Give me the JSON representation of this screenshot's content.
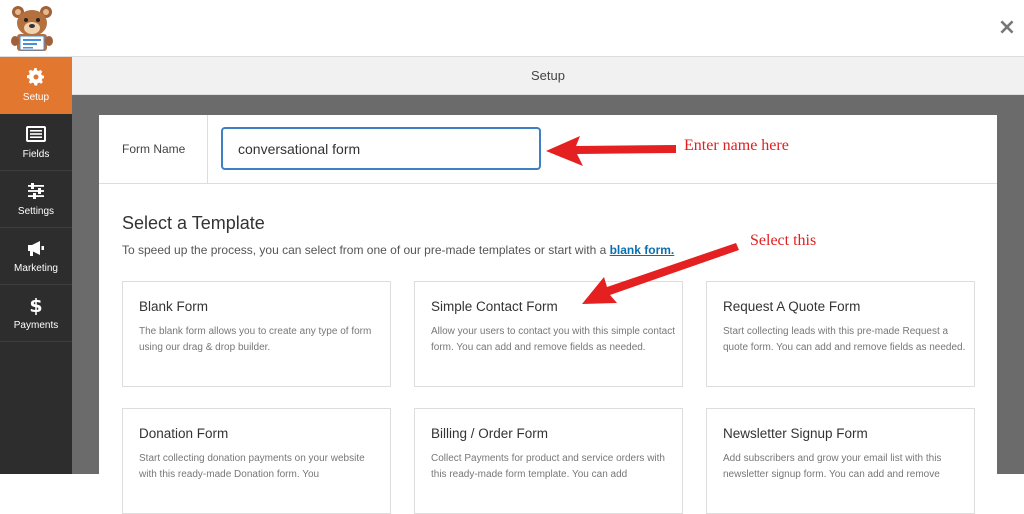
{
  "header": {
    "close_label": "×"
  },
  "sidebar": {
    "items": [
      {
        "label": "Setup",
        "icon": "gear-icon",
        "active": true
      },
      {
        "label": "Fields",
        "icon": "list-icon",
        "active": false
      },
      {
        "label": "Settings",
        "icon": "sliders-icon",
        "active": false
      },
      {
        "label": "Marketing",
        "icon": "megaphone-icon",
        "active": false
      },
      {
        "label": "Payments",
        "icon": "dollar-icon",
        "active": false
      }
    ]
  },
  "setup_bar": {
    "title": "Setup"
  },
  "form_name": {
    "label": "Form Name",
    "value": "conversational form"
  },
  "templates": {
    "title": "Select a Template",
    "description": "To speed up the process, you can select from one of our pre-made templates or start with a ",
    "blank_link": "blank form.",
    "cards": [
      {
        "title": "Blank Form",
        "desc": "The blank form allows you to create any type of form using our drag & drop builder."
      },
      {
        "title": "Simple Contact Form",
        "desc": "Allow your users to contact you with this simple contact form. You can add and remove fields as needed."
      },
      {
        "title": "Request A Quote Form",
        "desc": "Start collecting leads with this pre-made Request a quote form. You can add and remove fields as needed."
      },
      {
        "title": "Donation Form",
        "desc": "Start collecting donation payments on your website with this ready-made Donation form. You"
      },
      {
        "title": "Billing / Order Form",
        "desc": "Collect Payments for product and service orders with this ready-made form template. You can add"
      },
      {
        "title": "Newsletter Signup Form",
        "desc": "Add subscribers and grow your email list with this newsletter signup form. You can add and remove"
      }
    ]
  },
  "annotations": {
    "enter_name": "Enter name here",
    "select_this": "Select this"
  },
  "colors": {
    "accent": "#e27730",
    "sidebar": "#2d2d2d",
    "input_border": "#3f7fc3",
    "annotation": "#e02020",
    "link": "#0a6fb0"
  }
}
